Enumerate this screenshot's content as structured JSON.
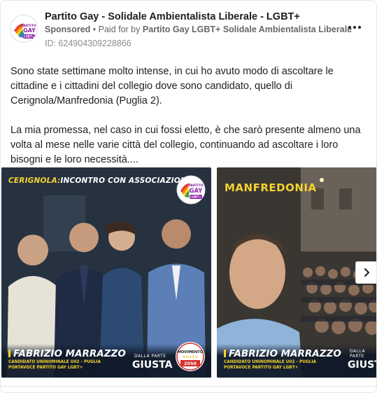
{
  "header": {
    "page_name": "Partito Gay - Solidale Ambientalista Liberale - LGBT+",
    "sponsored": "Sponsored",
    "separator": " • ",
    "paid_for_prefix": "Paid for by ",
    "paid_for_name": "Partito Gay LGBT+ Solidale Ambientalista Liberale",
    "ad_id": "ID: 624904309228866",
    "more_icon": "more-horizontal-icon"
  },
  "avatar": {
    "line1": "PARTITO",
    "line2": "GAY",
    "line3": "LGBT+"
  },
  "body": {
    "paragraph1": "Sono state settimane molto intense, in cui ho avuto modo di ascoltare le cittadine e i cittadini del collegio dove sono candidato, quello di Cerignola/Manfredonia (Puglia 2).",
    "paragraph2": "La mia promessa, nel caso in cui fossi eletto, è che sarò presente almeno una volta al mese nelle varie città del collegio, continuando ad ascoltare i loro bisogni e le loro necessità...."
  },
  "carousel": {
    "slides": [
      {
        "title_accent": "CERIGNOLA:",
        "title_rest": "INCONTRO CON ASSOCIAZIONI",
        "badge_line1": "PARTITO",
        "badge_line2": "GAY",
        "badge_line3": "LGBT+",
        "name": "FABRIZIO MARRAZZO",
        "sub1": "CANDIDATO UNINOMINALE U02 - PUGLIA",
        "sub2": "PORTAVOCE PARTITO GAY LGBT+",
        "giusta_small": "DALLA PARTE",
        "giusta_big": "GIUSTA",
        "movimento_label": "MOVIMENTO",
        "movimento_year": "2050"
      },
      {
        "title": "MANFREDONIA",
        "name": "FABRIZIO MARRAZZO",
        "sub1": "CANDIDATO UNINOMINALE U02 - PUGLIA",
        "sub2": "PORTAVOCE PARTITO GAY LGBT+",
        "giusta_small": "DALLA PARTE",
        "giusta_big": "GIUSTA"
      }
    ],
    "next_icon": "chevron-right-icon"
  },
  "colors": {
    "text_primary": "#1c1e21",
    "text_secondary": "#65676b",
    "accent_yellow": "#f5d22e",
    "rainbow": [
      "#e53935",
      "#fb8c00",
      "#fdd835",
      "#43a047",
      "#1e88e5",
      "#8e24aa"
    ]
  }
}
